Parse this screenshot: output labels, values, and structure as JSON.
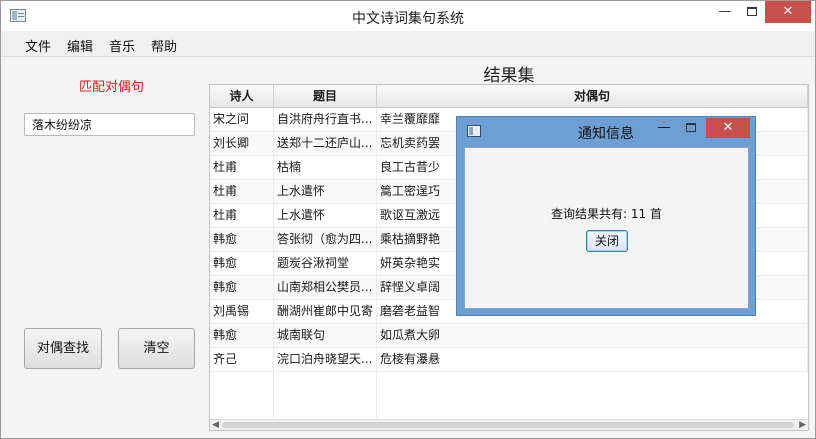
{
  "window": {
    "title": "中文诗词集句系统",
    "min_glyph": "—",
    "close_glyph": "✕"
  },
  "menu": [
    "文件",
    "编辑",
    "音乐",
    "帮助"
  ],
  "left_panel": {
    "match_label": "匹配对偶句",
    "input_value": "落木纷纷凉",
    "search_button": "对偶查找",
    "clear_button": "清空"
  },
  "results": {
    "title": "结果集",
    "columns": [
      "诗人",
      "题目",
      "对偶句"
    ],
    "rows": [
      [
        "宋之问",
        "自洪府舟行直书...",
        "幸兰覆靡靡"
      ],
      [
        "刘长卿",
        "送郑十二还庐山...",
        "忘机卖药罢"
      ],
      [
        "杜甫",
        "枯楠",
        "良工古昔少"
      ],
      [
        "杜甫",
        "上水遣怀",
        "篙工密逞巧"
      ],
      [
        "杜甫",
        "上水遣怀",
        "歌讴互激远"
      ],
      [
        "韩愈",
        "答张彻（愈为四...",
        "乘枯摘野艳"
      ],
      [
        "韩愈",
        "题炭谷湫祠堂",
        "妍英杂艳实"
      ],
      [
        "韩愈",
        "山南郑相公樊员...",
        "辞悭义卓阔"
      ],
      [
        "刘禹锡",
        "酬湖州崔郎中见寄",
        "磨砻老益智"
      ],
      [
        "韩愈",
        "城南联句",
        "如瓜煮大卵"
      ],
      [
        "齐己",
        "浣口泊舟晓望天...",
        "危棱有瀑悬"
      ]
    ]
  },
  "dialog": {
    "title": "通知信息",
    "message": "查询结果共有: 11 首",
    "close_button": "关闭",
    "min_glyph": "—",
    "close_glyph": "✕"
  },
  "colors": {
    "match_label": "#e02020",
    "dialog_frame": "#6d9fd5",
    "close_button": "#c7504b"
  }
}
